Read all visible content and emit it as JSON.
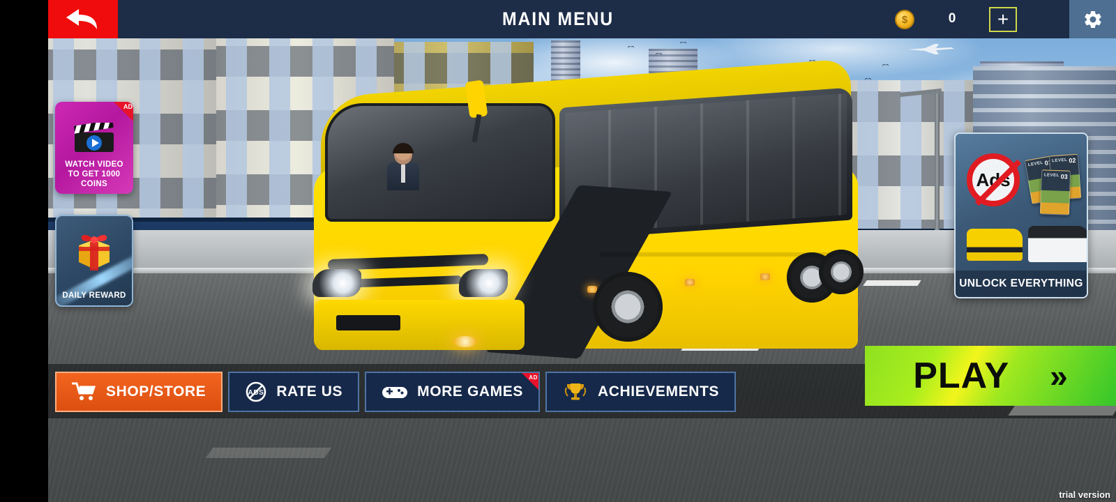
{
  "window": {
    "title": "MAIN MENU"
  },
  "topbar": {
    "back_icon": "back-arrow-icon",
    "title": "MAIN MENU",
    "coin_icon": "coin-icon",
    "coin_symbol": "$",
    "coin_count": "0",
    "add_coins_label": "+",
    "settings_icon": "gear-icon"
  },
  "promos": [
    {
      "id": "watch-video",
      "icon": "video-clapperboard-icon",
      "badge": "AD",
      "line1": "WATCH VIDEO",
      "line2": "TO GET 1000 COINS",
      "color": "#c928b0"
    },
    {
      "id": "daily-reward",
      "icon": "gift-box-icon",
      "label": "DAILY REWARD",
      "color": "#2c4764"
    }
  ],
  "unlock_panel": {
    "label": "UNLOCK EVERYTHING",
    "no_ads_text": "Ads",
    "level_cards": [
      {
        "caption": "LEVEL",
        "number": "01"
      },
      {
        "caption": "LEVEL",
        "number": "02"
      },
      {
        "caption": "LEVEL",
        "number": "03"
      }
    ],
    "bus_yellow": "yellow-bus-thumbnail",
    "bus_white": "white-bus-thumbnail"
  },
  "bottom_buttons": [
    {
      "id": "shop-store",
      "label": "SHOP/STORE",
      "icon": "shopping-cart-icon",
      "badge": "",
      "style": "orange"
    },
    {
      "id": "rate-us",
      "label": "RATE US",
      "icon": "no-ads-icon",
      "badge": "",
      "style": "dark"
    },
    {
      "id": "more-games",
      "label": "MORE GAMES",
      "icon": "gamepad-icon",
      "badge": "AD",
      "style": "dark"
    },
    {
      "id": "achievements",
      "label": "ACHIEVEMENTS",
      "icon": "trophy-icon",
      "badge": "",
      "style": "dark"
    }
  ],
  "play_button": {
    "label": "PLAY",
    "chevron": "»"
  },
  "watermark": {
    "text": "trial version"
  },
  "colors": {
    "topbar": "#1d2c47",
    "back": "#f00c0c",
    "accent_orange": "#ee5f1a",
    "accent_green": "#9fe81f",
    "panel_dark": "#16294a",
    "coin_gold": "#f5b722",
    "ad_red": "#e8122a"
  }
}
